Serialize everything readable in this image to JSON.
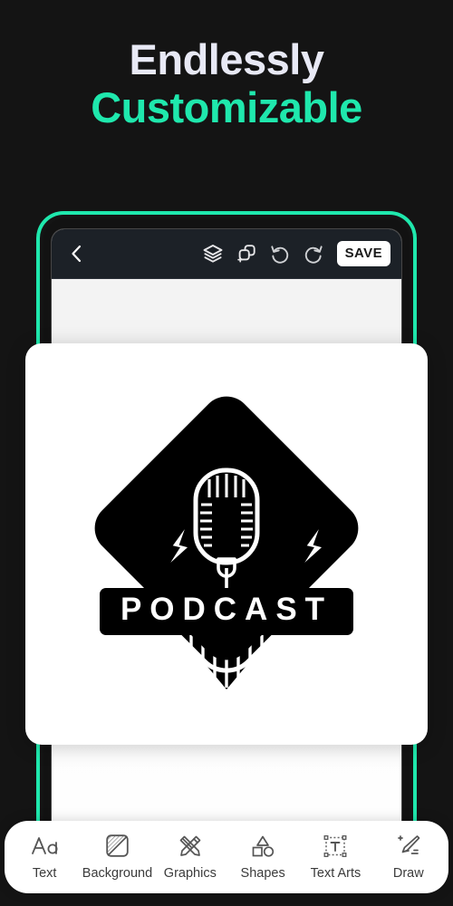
{
  "headline": {
    "line1": "Endlessly",
    "line2": "Customizable",
    "color_line1": "#e8e9f5",
    "color_line2": "#1fe8ad"
  },
  "theme": {
    "background": "#141414",
    "accent_green": "#1fe8ad",
    "topbar_background": "#1c2127",
    "canvas_background": "#f2f2f2",
    "card_background": "#ffffff"
  },
  "editor": {
    "topbar": {
      "back_icon": "chevron-left-icon",
      "actions": [
        {
          "name": "layers-icon",
          "label": "Layers"
        },
        {
          "name": "duplicate-add-icon",
          "label": "Add Layer"
        },
        {
          "name": "undo-icon",
          "label": "Undo"
        },
        {
          "name": "redo-icon",
          "label": "Redo"
        }
      ],
      "save_label": "SAVE"
    },
    "canvas": {
      "artwork": {
        "name": "podcast-logo",
        "banner_text": "PODCAST",
        "elements": [
          "rounded-diamond-badge",
          "retro-microphone",
          "lightning-bolt-left",
          "lightning-bolt-right",
          "banner-ribbon",
          "radiating-stripes"
        ],
        "fill": "#000000",
        "detail": "#ffffff"
      }
    }
  },
  "toolbar": {
    "items": [
      {
        "icon": "text-aa-icon",
        "label": "Text"
      },
      {
        "icon": "background-icon",
        "label": "Background"
      },
      {
        "icon": "graphics-icon",
        "label": "Graphics"
      },
      {
        "icon": "shapes-icon",
        "label": "Shapes"
      },
      {
        "icon": "text-arts-icon",
        "label": "Text Arts"
      },
      {
        "icon": "draw-icon",
        "label": "Draw"
      }
    ]
  }
}
